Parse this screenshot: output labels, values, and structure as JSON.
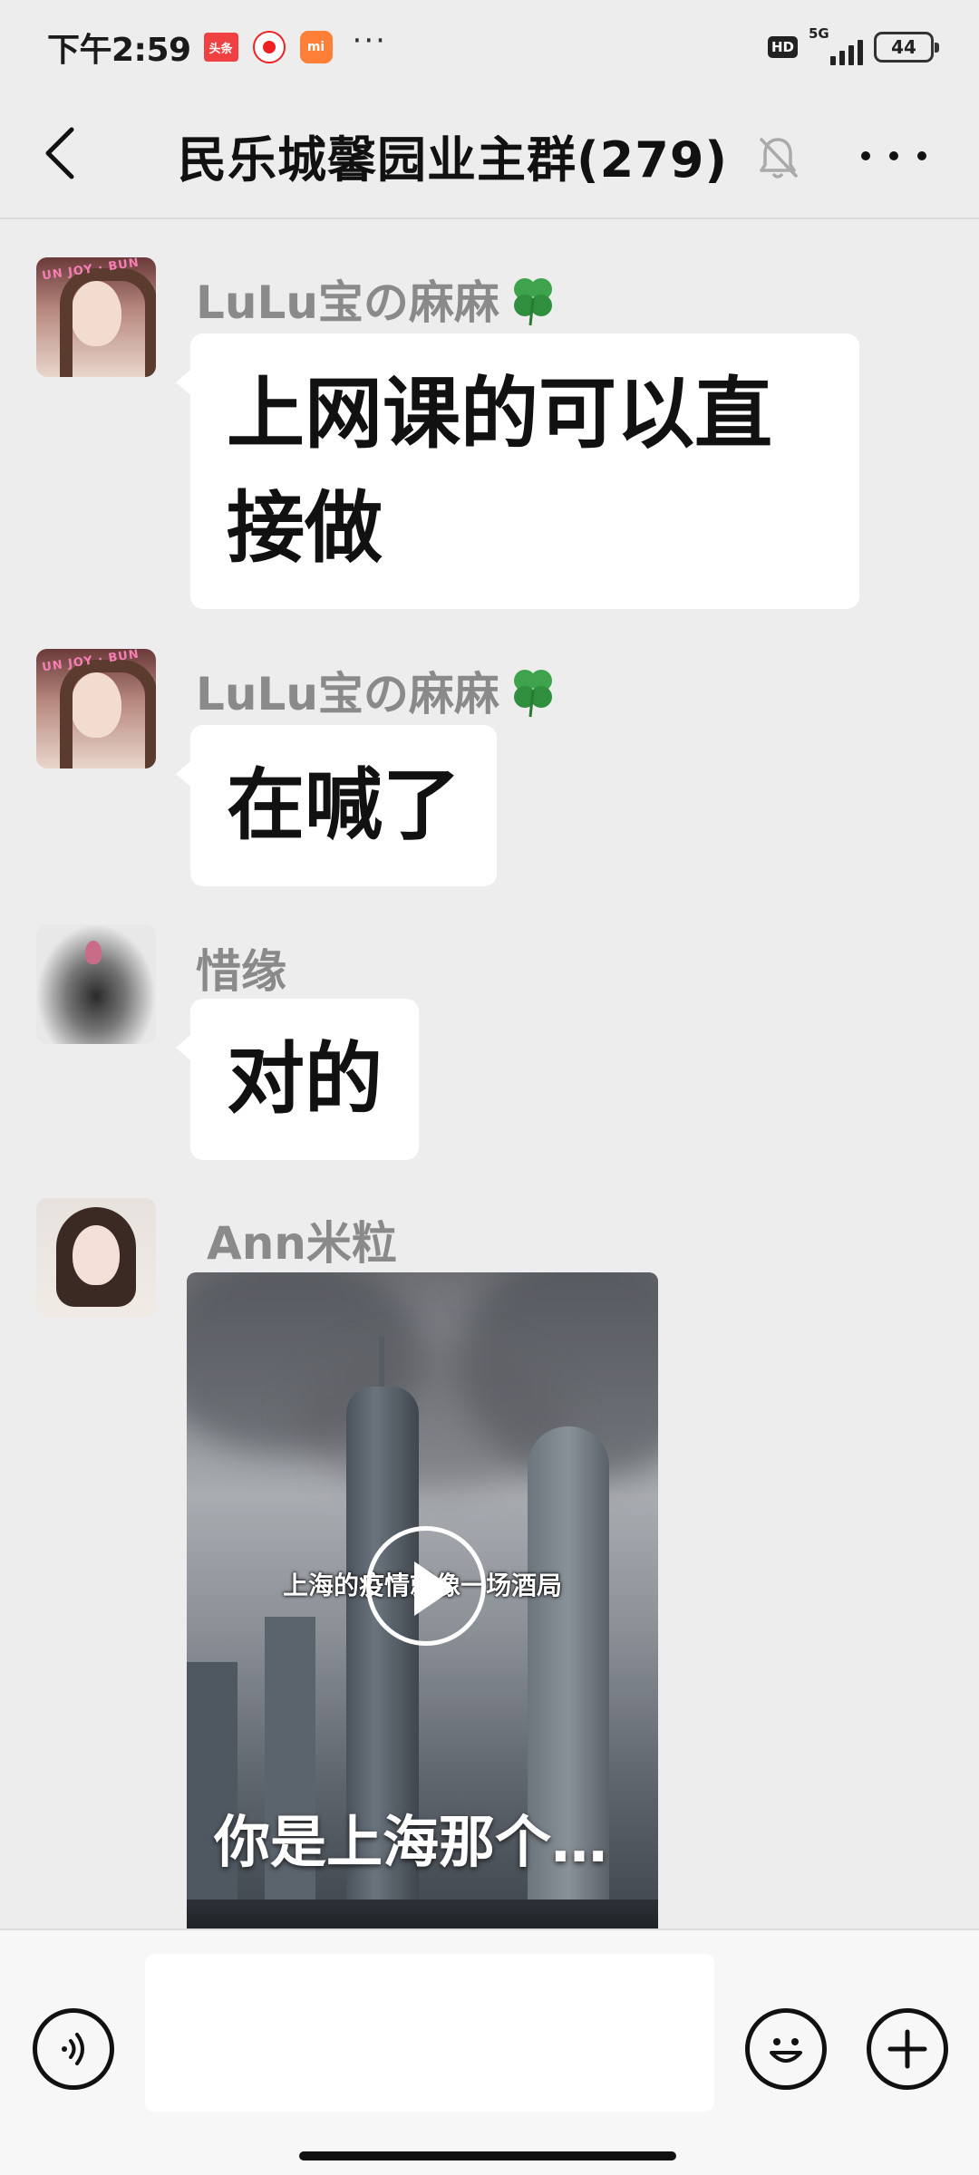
{
  "status_bar": {
    "time": "下午2:59",
    "app_icons": [
      "头条",
      "",
      "mi"
    ],
    "more": "···",
    "hd": "HD",
    "network": "5G",
    "battery": "44"
  },
  "header": {
    "title": "民乐城馨园业主群(279)",
    "back_icon": "chevron-left-icon",
    "mute_icon": "bell-off-icon",
    "more_icon": "more-dots-icon"
  },
  "messages": [
    {
      "sender": "LuLu宝の麻麻",
      "text": "上网课的可以直接做",
      "avatar_text": "UN JOY · BUN"
    },
    {
      "sender": "LuLu宝の麻麻",
      "text": "在喊了",
      "avatar_text": "UN JOY · BUN"
    },
    {
      "sender": "惜缘",
      "text": "对的"
    },
    {
      "sender": "Ann米粒",
      "video": {
        "caption_mid": "上海的疫情就像一场酒局",
        "caption_big": "你是上海那个…"
      }
    }
  ],
  "input_bar": {
    "placeholder": "",
    "voice_icon": "voice-icon",
    "emoji_icon": "emoji-icon",
    "plus_icon": "plus-icon"
  },
  "colors": {
    "background": "#ededed",
    "bubble": "#ffffff",
    "sender_name": "#8a8a8a"
  }
}
